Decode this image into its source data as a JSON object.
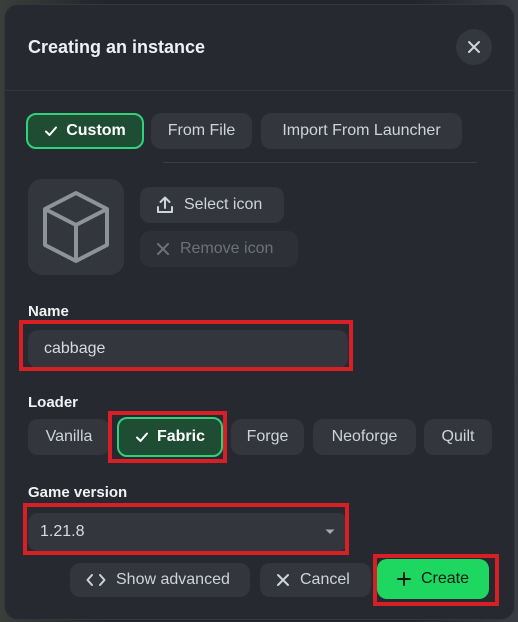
{
  "dialog": {
    "title": "Creating an instance"
  },
  "source_tabs": [
    {
      "label": "Custom",
      "selected": true
    },
    {
      "label": "From File",
      "selected": false
    },
    {
      "label": "Import From Launcher",
      "selected": false
    }
  ],
  "icon_actions": {
    "select_label": "Select icon",
    "remove_label": "Remove icon"
  },
  "name_field": {
    "label": "Name",
    "value": "cabbage"
  },
  "loader": {
    "label": "Loader",
    "options": [
      {
        "label": "Vanilla",
        "selected": false
      },
      {
        "label": "Fabric",
        "selected": true
      },
      {
        "label": "Forge",
        "selected": false
      },
      {
        "label": "Neoforge",
        "selected": false
      },
      {
        "label": "Quilt",
        "selected": false
      }
    ]
  },
  "game_version": {
    "label": "Game version",
    "value": "1.21.8"
  },
  "footer": {
    "advanced_label": "Show advanced",
    "cancel_label": "Cancel",
    "create_label": "Create"
  },
  "colors": {
    "accent": "#1ed760",
    "highlight": "#d81f26",
    "background": "#26292f"
  },
  "icons": {
    "close": "close-icon",
    "check": "check-icon",
    "placeholder": "cube-icon",
    "upload": "upload-icon",
    "remove": "x-icon",
    "code": "code-icon",
    "chevron": "chevron-down-icon",
    "plus": "plus-icon"
  }
}
